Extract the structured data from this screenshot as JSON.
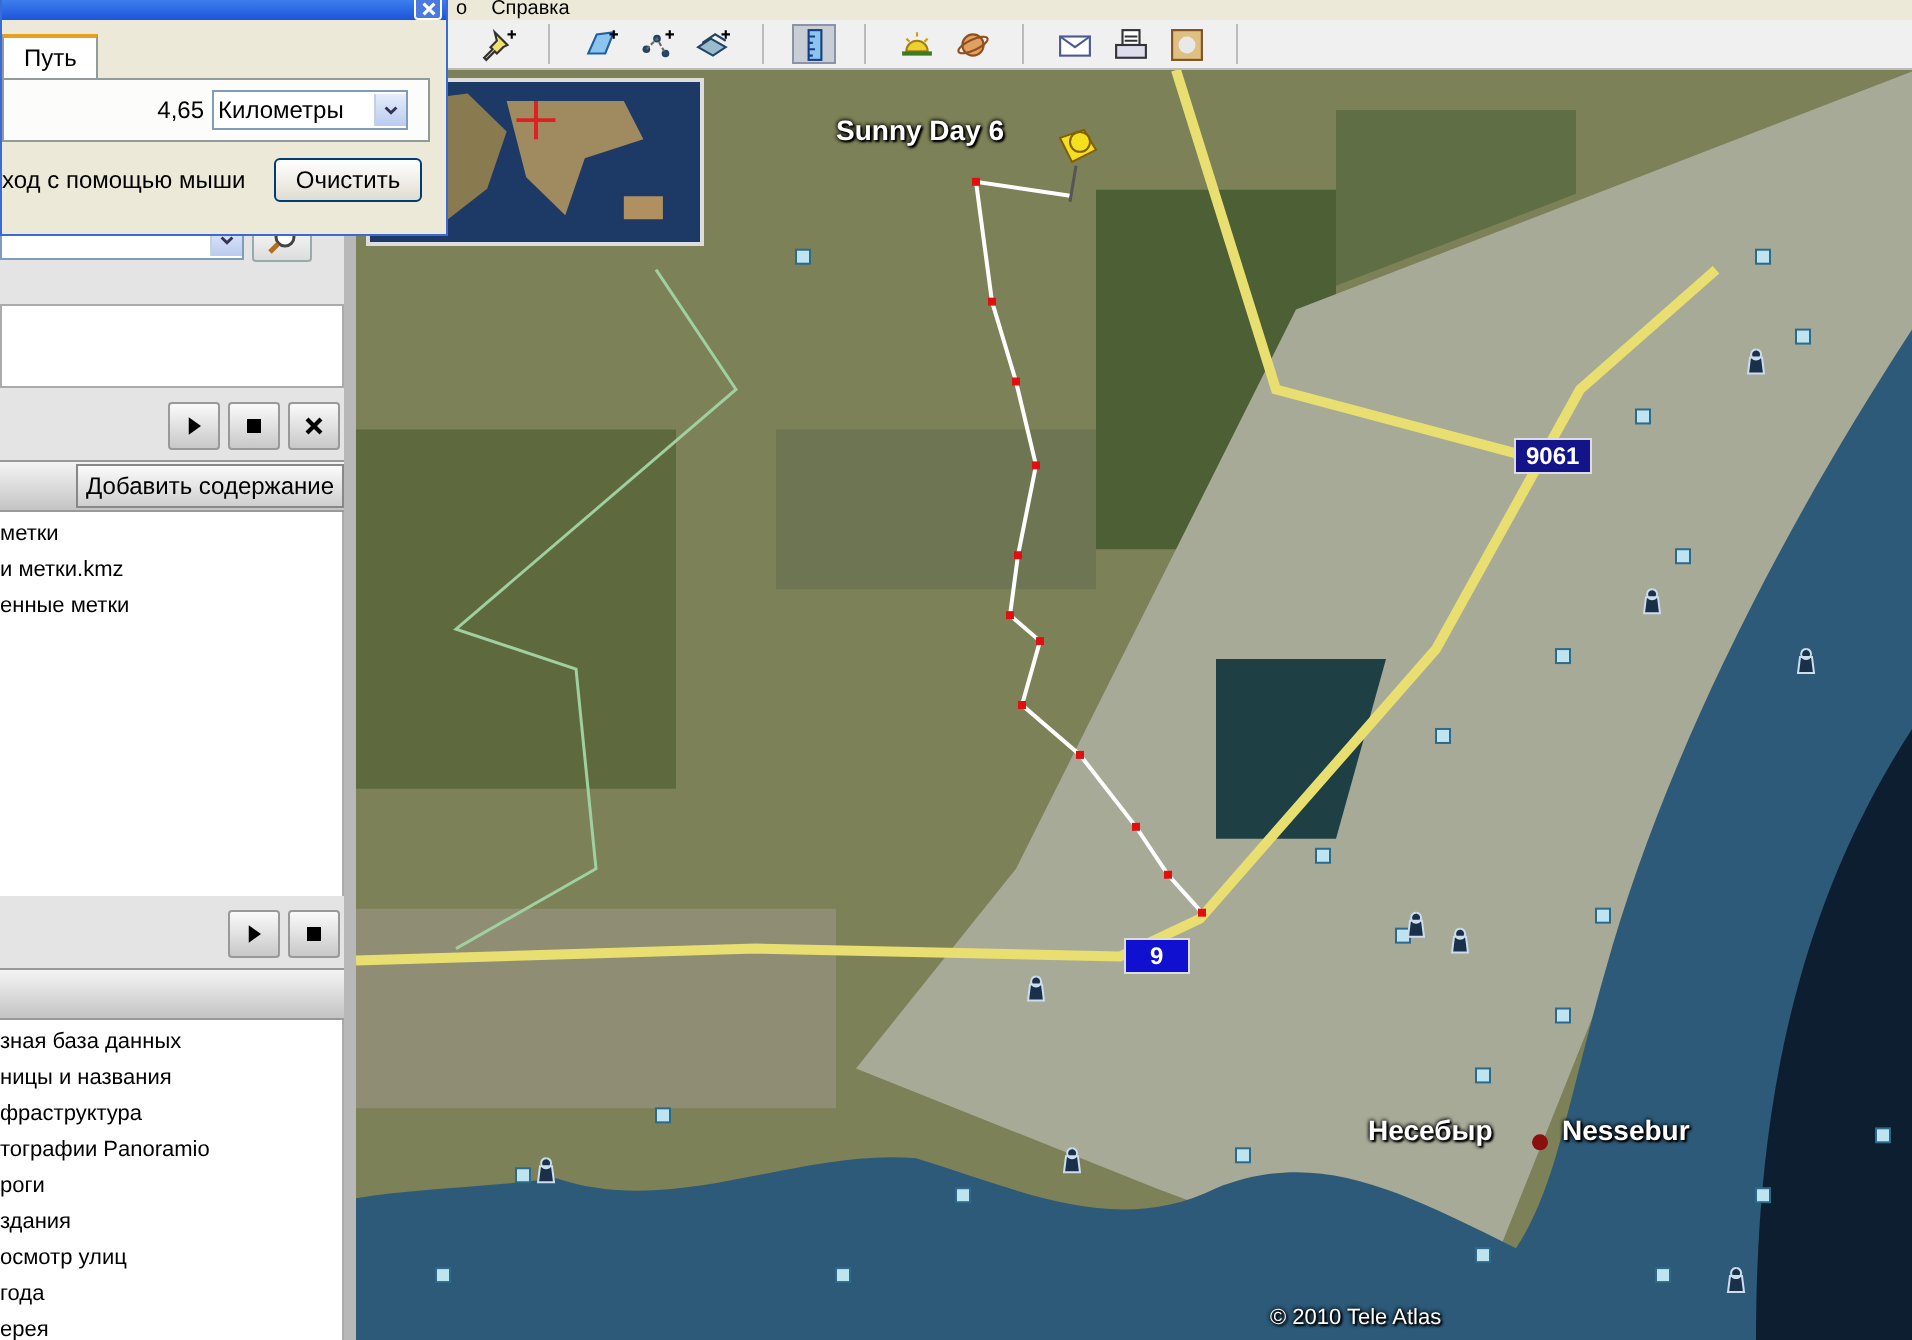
{
  "menu_bar": {
    "items": [
      "о",
      "Справка"
    ]
  },
  "ruler_dialog": {
    "tabs": [
      {
        "label": "Путь",
        "selected": true
      }
    ],
    "length": "4,65",
    "unit": "Километры",
    "mouse_navigation_label": "ход с помощью мыши",
    "clear_button": "Очистить"
  },
  "toolbar_groups": [
    {
      "buttons": [
        {
          "kind": "placemark",
          "selected": false
        }
      ]
    },
    {
      "buttons": [
        {
          "kind": "polygon",
          "selected": false
        },
        {
          "kind": "path",
          "selected": false
        },
        {
          "kind": "overlay",
          "selected": false
        }
      ]
    },
    {
      "buttons": [
        {
          "kind": "ruler",
          "selected": true
        }
      ]
    },
    {
      "buttons": [
        {
          "kind": "sun",
          "selected": false
        },
        {
          "kind": "planet",
          "selected": false
        }
      ]
    },
    {
      "buttons": [
        {
          "kind": "email",
          "selected": false
        },
        {
          "kind": "print",
          "selected": false
        },
        {
          "kind": "image",
          "selected": false
        }
      ]
    }
  ],
  "tour_controls": [
    {
      "kind": "play"
    },
    {
      "kind": "stop"
    },
    {
      "kind": "close"
    }
  ],
  "places": {
    "add_content_button": "Добавить содержание",
    "items": [
      "метки",
      "и метки.kmz",
      "енные метки"
    ]
  },
  "layer_controls": [
    {
      "kind": "play"
    },
    {
      "kind": "stop"
    }
  ],
  "layers": {
    "items": [
      "зная база данных",
      "ницы и названия",
      "фраструктура",
      "тографии Panoramio",
      "роги",
      "здания",
      "осмотр улиц",
      "года",
      "ерея"
    ]
  },
  "map": {
    "placemark_label": "Sunny Day 6",
    "road_shields": [
      {
        "label": "9061",
        "kind": "regional"
      },
      {
        "label": "9",
        "kind": "national"
      }
    ],
    "city_labels": [
      "Несебыр",
      "Nessebur"
    ],
    "copyright": "© 2010 Tele Atlas"
  }
}
